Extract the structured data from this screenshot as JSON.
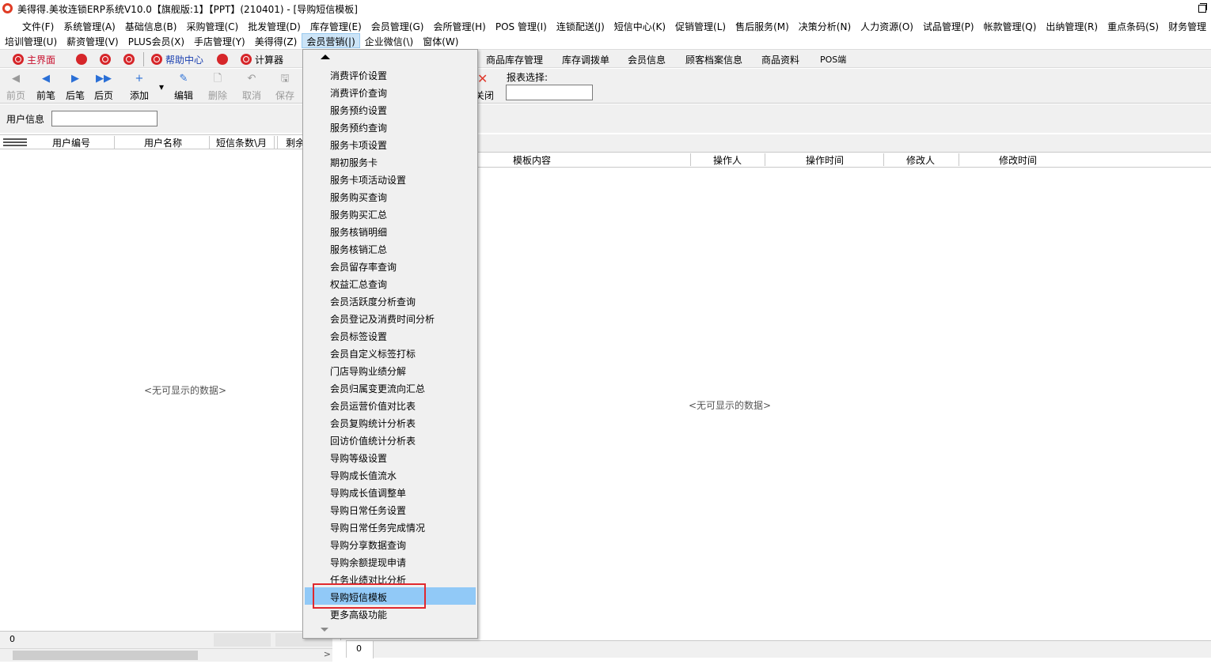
{
  "window": {
    "title": "美得得.美妆连锁ERP系统V10.0【旗舰版:1】【PPT】(210401) - [导购短信模板]"
  },
  "menubar_row1": [
    "文件(F)",
    "系统管理(A)",
    "基础信息(B)",
    "采购管理(C)",
    "批发管理(D)",
    "库存管理(E)",
    "会员管理(G)",
    "会所管理(H)",
    "POS 管理(I)",
    "连锁配送(J)",
    "短信中心(K)",
    "促销管理(L)",
    "售后服务(M)",
    "决策分析(N)",
    "人力资源(O)",
    "试品管理(P)",
    "帐款管理(Q)",
    "出纳管理(R)",
    "重点条码(S)",
    "财务管理"
  ],
  "menubar_row2": [
    "培训管理(U)",
    "薪资管理(V)",
    "PLUS会员(X)",
    "手店管理(Y)",
    "美得得(Z)",
    "会员营销(|)",
    "企业微信(\\)",
    "窗体(W)"
  ],
  "toolbar1": {
    "home": "主界面",
    "help": "帮助中心",
    "calculator": "计算器",
    "tabs_right": [
      "商品库存管理",
      "库存调拨单",
      "会员信息",
      "顾客档案信息",
      "商品资料",
      "POS端"
    ]
  },
  "toolbar2": {
    "buttons": [
      {
        "label": "前页",
        "icon": "◀",
        "disabled": true
      },
      {
        "label": "前笔",
        "icon": "◀",
        "disabled": false
      },
      {
        "label": "后笔",
        "icon": "▶",
        "disabled": false
      },
      {
        "label": "后页",
        "icon": "▶▶",
        "disabled": false
      },
      {
        "label": "添加",
        "icon": "+",
        "disabled": false
      },
      {
        "label": "编辑",
        "icon": "✎",
        "disabled": false
      },
      {
        "label": "删除",
        "icon": "🗋",
        "disabled": true
      },
      {
        "label": "取消",
        "icon": "↶",
        "disabled": true
      },
      {
        "label": "保存",
        "icon": "🖫",
        "disabled": true
      }
    ],
    "close_label": "关闭",
    "report_label": "报表选择:"
  },
  "filter": {
    "user_info_label": "用户信息",
    "user_info_value": ""
  },
  "left_grid": {
    "columns": [
      "用户编号",
      "用户名称",
      "短信条数\\月",
      "剩余"
    ],
    "empty_text": "<无可显示的数据>",
    "record_count": "0"
  },
  "right_grid": {
    "columns": [
      "模板内容",
      "操作人",
      "操作时间",
      "修改人",
      "修改时间"
    ],
    "empty_text": "<无可显示的数据>",
    "record_count": "0"
  },
  "dropdown": {
    "items": [
      "消费评价设置",
      "消费评价查询",
      "服务预约设置",
      "服务预约查询",
      "服务卡项设置",
      "期初服务卡",
      "服务卡项活动设置",
      "服务购买查询",
      "服务购买汇总",
      "服务核销明细",
      "服务核销汇总",
      "会员留存率查询",
      "权益汇总查询",
      "会员活跃度分析查询",
      "会员登记及消费时间分析",
      "会员标签设置",
      "会员自定义标签打标",
      "门店导购业绩分解",
      "会员归属变更流向汇总",
      "会员运营价值对比表",
      "会员复购统计分析表",
      "回访价值统计分析表",
      "导购等级设置",
      "导购成长值流水",
      "导购成长值调整单",
      "导购日常任务设置",
      "导购日常任务完成情况",
      "导购分享数据查询",
      "导购余额提现申请",
      "任务业绩对比分析",
      "导购短信模板",
      "更多高级功能"
    ],
    "highlighted": "导购短信模板"
  },
  "colors": {
    "accent_red": "#e0282e",
    "highlight_blue": "#91c9f7",
    "menu_active": "#cce4f7"
  }
}
